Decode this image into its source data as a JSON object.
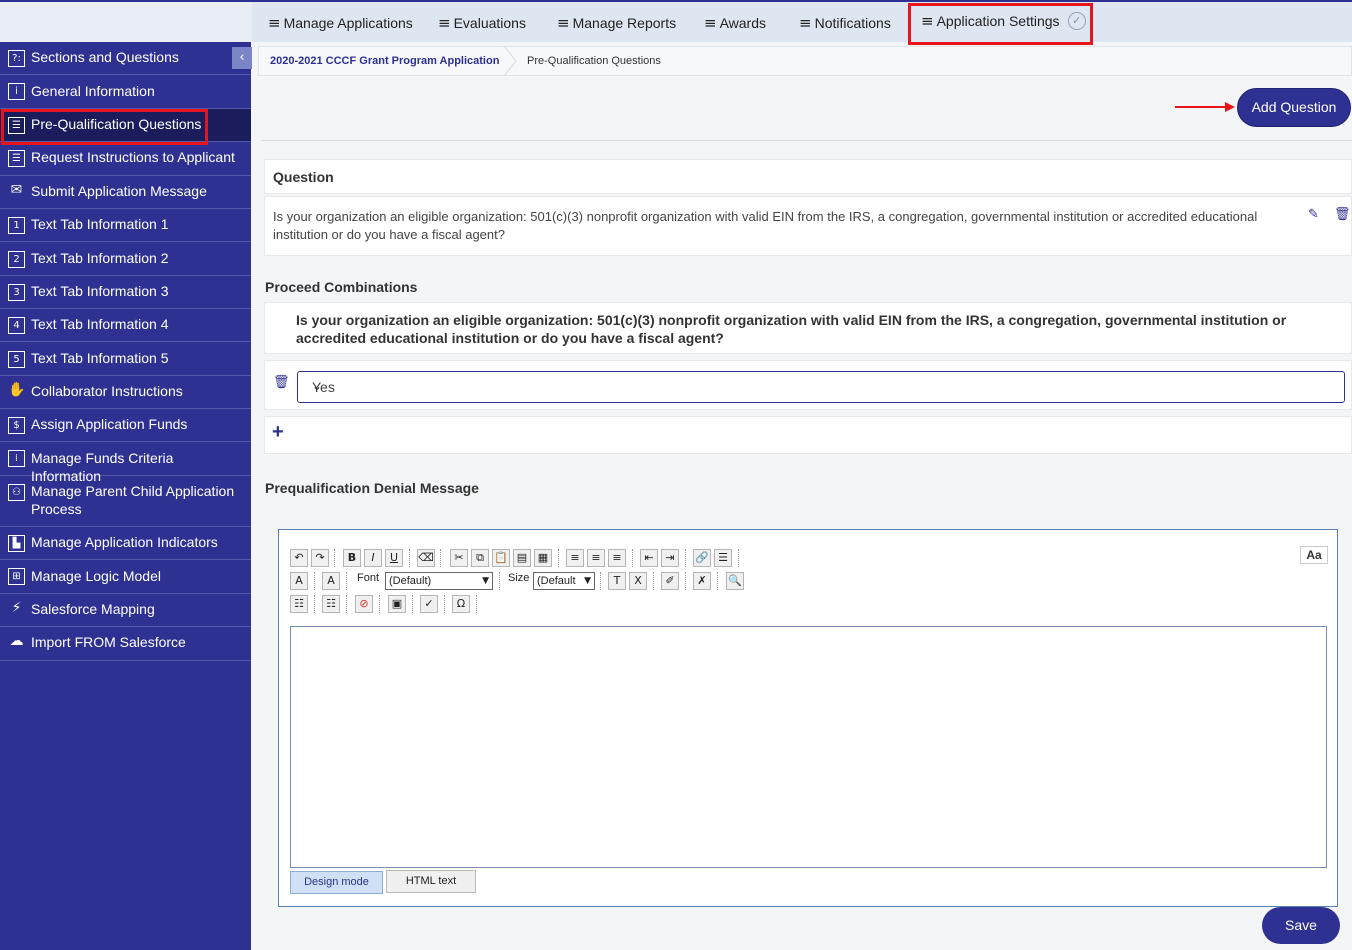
{
  "topnav": {
    "items": [
      {
        "label": "Manage Applications"
      },
      {
        "label": "Evaluations"
      },
      {
        "label": "Manage Reports"
      },
      {
        "label": "Awards"
      },
      {
        "label": "Notifications"
      },
      {
        "label": "Application Settings"
      }
    ],
    "highlight_color": "#e8141c"
  },
  "sidebar": {
    "items": [
      {
        "label": "Sections and Questions",
        "icon": "question-list-icon"
      },
      {
        "label": "General Information",
        "icon": "info-icon"
      },
      {
        "label": "Pre-Qualification Questions",
        "icon": "checklist-icon",
        "active": true
      },
      {
        "label": "Request Instructions to Applicant",
        "icon": "list-icon"
      },
      {
        "label": "Submit Application Message",
        "icon": "message-icon"
      },
      {
        "label": "Text Tab Information 1",
        "icon": "tab-1-icon",
        "num": "1"
      },
      {
        "label": "Text Tab Information 2",
        "icon": "tab-2-icon",
        "num": "2"
      },
      {
        "label": "Text Tab Information 3",
        "icon": "tab-3-icon",
        "num": "3"
      },
      {
        "label": "Text Tab Information 4",
        "icon": "tab-4-icon",
        "num": "4"
      },
      {
        "label": "Text Tab Information 5",
        "icon": "tab-5-icon",
        "num": "5"
      },
      {
        "label": "Collaborator Instructions",
        "icon": "handshake-icon"
      },
      {
        "label": "Assign Application Funds",
        "icon": "funds-icon"
      },
      {
        "label": "Manage Funds Criteria Information",
        "icon": "criteria-icon"
      },
      {
        "label": "Manage Parent Child Application Process",
        "icon": "parent-child-icon"
      },
      {
        "label": "Manage Application Indicators",
        "icon": "indicators-icon"
      },
      {
        "label": "Manage Logic Model",
        "icon": "logic-model-icon"
      },
      {
        "label": "Salesforce Mapping",
        "icon": "plug-icon"
      },
      {
        "label": "Import FROM Salesforce",
        "icon": "cloud-icon"
      }
    ],
    "bg_color": "#2e3192"
  },
  "breadcrumb": {
    "program": "2020-2021 CCCF Grant Program Application",
    "current": "Pre-Qualification Questions"
  },
  "actions": {
    "add_question": "Add Question",
    "save": "Save"
  },
  "question": {
    "header": "Question",
    "text": "Is your organization an eligible organization: 501(c)(3) nonprofit organization with valid EIN from the IRS, a congregation, governmental institution or accredited educational institution or do you have a fiscal agent?"
  },
  "proceed": {
    "title": "Proceed Combinations",
    "question": "Is your organization an eligible organization: 501(c)(3) nonprofit organization with valid EIN from the IRS, a congregation, governmental institution or accredited educational institution or do you have a fiscal agent?",
    "selected_answer": "Yes",
    "add_symbol": "+"
  },
  "denial": {
    "title": "Prequalification Denial Message"
  },
  "editor": {
    "font_label": "Font",
    "font_value": "(Default)",
    "size_label": "Size",
    "size_value": "(Default",
    "aa_label": "Aa",
    "design_tab": "Design mode",
    "html_tab": "HTML text"
  }
}
